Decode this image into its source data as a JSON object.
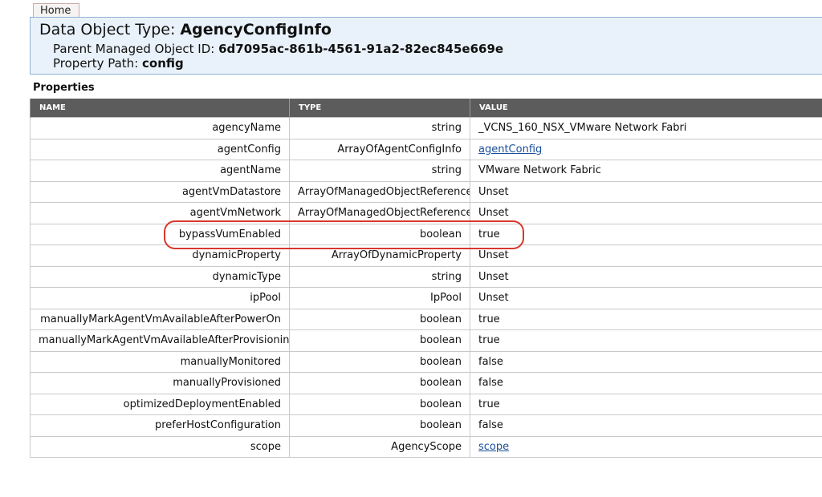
{
  "nav": {
    "home_label": "Home"
  },
  "header": {
    "title_prefix": "Data Object Type: ",
    "title_value": "AgencyConfigInfo",
    "parent_prefix": "Parent Managed Object ID: ",
    "parent_value": "6d7095ac-861b-4561-91a2-82ec845e669e",
    "path_prefix": "Property Path: ",
    "path_value": "config"
  },
  "properties": {
    "heading": "Properties",
    "columns": [
      "NAME",
      "TYPE",
      "VALUE"
    ],
    "rows": [
      {
        "name": "agencyName",
        "type": "string",
        "value": "_VCNS_160_NSX_VMware Network Fabri",
        "link": false
      },
      {
        "name": "agentConfig",
        "type": "ArrayOfAgentConfigInfo",
        "value": "agentConfig",
        "link": true
      },
      {
        "name": "agentName",
        "type": "string",
        "value": "VMware Network Fabric",
        "link": false
      },
      {
        "name": "agentVmDatastore",
        "type": "ArrayOfManagedObjectReference",
        "value": "Unset",
        "link": false
      },
      {
        "name": "agentVmNetwork",
        "type": "ArrayOfManagedObjectReference",
        "value": "Unset",
        "link": false
      },
      {
        "name": "bypassVumEnabled",
        "type": "boolean",
        "value": "true",
        "link": false
      },
      {
        "name": "dynamicProperty",
        "type": "ArrayOfDynamicProperty",
        "value": "Unset",
        "link": false
      },
      {
        "name": "dynamicType",
        "type": "string",
        "value": "Unset",
        "link": false
      },
      {
        "name": "ipPool",
        "type": "IpPool",
        "value": "Unset",
        "link": false
      },
      {
        "name": "manuallyMarkAgentVmAvailableAfterPowerOn",
        "type": "boolean",
        "value": "true",
        "link": false
      },
      {
        "name": "manuallyMarkAgentVmAvailableAfterProvisioning",
        "type": "boolean",
        "value": "true",
        "link": false
      },
      {
        "name": "manuallyMonitored",
        "type": "boolean",
        "value": "false",
        "link": false
      },
      {
        "name": "manuallyProvisioned",
        "type": "boolean",
        "value": "false",
        "link": false
      },
      {
        "name": "optimizedDeploymentEnabled",
        "type": "boolean",
        "value": "true",
        "link": false
      },
      {
        "name": "preferHostConfiguration",
        "type": "boolean",
        "value": "false",
        "link": false
      },
      {
        "name": "scope",
        "type": "AgencyScope",
        "value": "scope",
        "link": true
      }
    ],
    "highlighted_row": "bypassVumEnabled"
  },
  "colors": {
    "header_bg": "#e9f2fb",
    "table_header_bg": "#5c5c5c",
    "link": "#1a4f9c",
    "highlight": "#d9372b"
  }
}
